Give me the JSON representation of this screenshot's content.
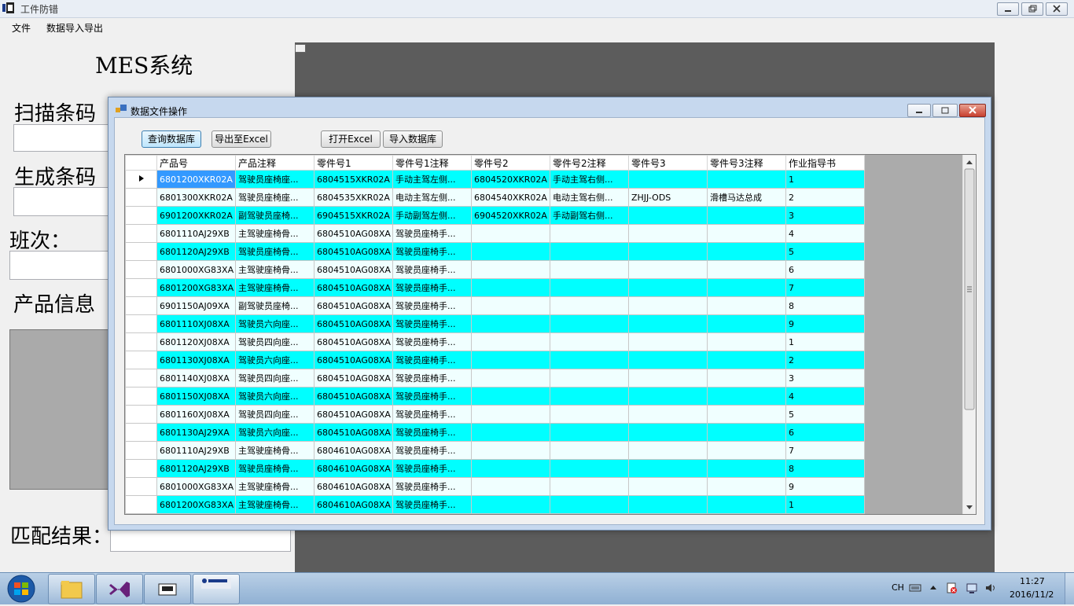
{
  "window": {
    "title": "工件防错"
  },
  "menu": [
    "文件",
    "数据导入导出"
  ],
  "left": {
    "heading": "MES系统",
    "scan_label": "扫描条码",
    "generate_label": "生成条码",
    "shift_label": "班次：",
    "product_label": "产品信息",
    "match_label": "匹配结果："
  },
  "dialog": {
    "title": "数据文件操作",
    "buttons": {
      "query": "查询数据库",
      "export": "导出至Excel",
      "open": "打开Excel",
      "import": "导入数据库"
    }
  },
  "grid": {
    "columns": [
      "产品号",
      "产品注释",
      "零件号1",
      "零件号1注释",
      "零件号2",
      "零件号2注释",
      "零件号3",
      "零件号3注释",
      "作业指导书"
    ],
    "rows": [
      [
        "6801200XKR02A",
        "驾驶员座椅座...",
        "6804515XKR02A",
        "手动主驾左侧...",
        "6804520XKR02A",
        "手动主驾右侧...",
        "",
        "",
        "1"
      ],
      [
        "6801300XKR02A",
        "驾驶员座椅座...",
        "6804535XKR02A",
        "电动主驾左侧...",
        "6804540XKR02A",
        "电动主驾右侧...",
        "ZHJJ-ODS",
        "滑槽马达总成",
        "2"
      ],
      [
        "6901200XKR02A",
        "副驾驶员座椅...",
        "6904515XKR02A",
        "手动副驾左侧...",
        "6904520XKR02A",
        "手动副驾右侧...",
        "",
        "",
        "3"
      ],
      [
        "6801110AJ29XB",
        "主驾驶座椅骨...",
        "6804510AG08XA",
        "驾驶员座椅手...",
        "",
        "",
        "",
        "",
        "4"
      ],
      [
        "6801120AJ29XB",
        "驾驶员座椅骨...",
        "6804510AG08XA",
        "驾驶员座椅手...",
        "",
        "",
        "",
        "",
        "5"
      ],
      [
        "6801000XG83XA",
        "主驾驶座椅骨...",
        "6804510AG08XA",
        "驾驶员座椅手...",
        "",
        "",
        "",
        "",
        "6"
      ],
      [
        "6801200XG83XA",
        "主驾驶座椅骨...",
        "6804510AG08XA",
        "驾驶员座椅手...",
        "",
        "",
        "",
        "",
        "7"
      ],
      [
        "6901150AJ09XA",
        "副驾驶员座椅...",
        "6804510AG08XA",
        "驾驶员座椅手...",
        "",
        "",
        "",
        "",
        "8"
      ],
      [
        "6801110XJ08XA",
        "驾驶员六向座...",
        "6804510AG08XA",
        "驾驶员座椅手...",
        "",
        "",
        "",
        "",
        "9"
      ],
      [
        "6801120XJ08XA",
        "驾驶员四向座...",
        "6804510AG08XA",
        "驾驶员座椅手...",
        "",
        "",
        "",
        "",
        "1"
      ],
      [
        "6801130XJ08XA",
        "驾驶员六向座...",
        "6804510AG08XA",
        "驾驶员座椅手...",
        "",
        "",
        "",
        "",
        "2"
      ],
      [
        "6801140XJ08XA",
        "驾驶员四向座...",
        "6804510AG08XA",
        "驾驶员座椅手...",
        "",
        "",
        "",
        "",
        "3"
      ],
      [
        "6801150XJ08XA",
        "驾驶员六向座...",
        "6804510AG08XA",
        "驾驶员座椅手...",
        "",
        "",
        "",
        "",
        "4"
      ],
      [
        "6801160XJ08XA",
        "驾驶员四向座...",
        "6804510AG08XA",
        "驾驶员座椅手...",
        "",
        "",
        "",
        "",
        "5"
      ],
      [
        "6801130AJ29XA",
        "驾驶员六向座...",
        "6804510AG08XA",
        "驾驶员座椅手...",
        "",
        "",
        "",
        "",
        "6"
      ],
      [
        "6801110AJ29XB",
        "主驾驶座椅骨...",
        "6804610AG08XA",
        "驾驶员座椅手...",
        "",
        "",
        "",
        "",
        "7"
      ],
      [
        "6801120AJ29XB",
        "驾驶员座椅骨...",
        "6804610AG08XA",
        "驾驶员座椅手...",
        "",
        "",
        "",
        "",
        "8"
      ],
      [
        "6801000XG83XA",
        "主驾驶座椅骨...",
        "6804610AG08XA",
        "驾驶员座椅手...",
        "",
        "",
        "",
        "",
        "9"
      ],
      [
        "6801200XG83XA",
        "主驾驶座椅骨...",
        "6804610AG08XA",
        "驾驶员座椅手...",
        "",
        "",
        "",
        "",
        "1"
      ]
    ]
  },
  "taskbar": {
    "lang": "CH",
    "time": "11:27",
    "date": "2016/11/2",
    "pinned_icons": [
      "windows-explorer-icon",
      "visual-studio-icon",
      "device-app-icon",
      "jackton-app-icon"
    ]
  }
}
